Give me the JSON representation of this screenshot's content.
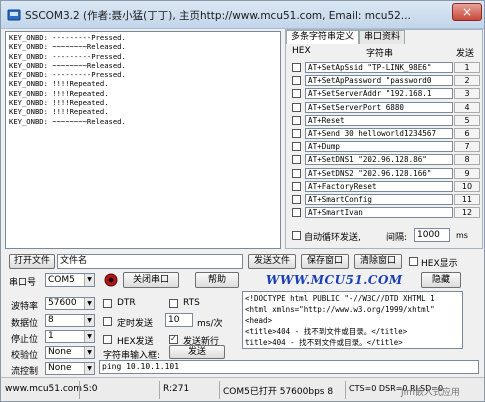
{
  "window": {
    "title": "SSCOM3.2 (作者:聂小猛(丁丁), 主页http://www.mcu51.com,  Email: mcu52...",
    "close": "×"
  },
  "receive_lines": [
    "KEY_ONBD: ---------Pressed.",
    "KEY_ONBD: ~~~~~~~~Released.",
    "KEY_ONBD: ---------Pressed.",
    "KEY_ONBD: ~~~~~~~~Released.",
    "KEY_ONBD: ---------Pressed.",
    "KEY_ONBD: !!!!Repeated.",
    "KEY_ONBD: !!!!Repeated.",
    "KEY_ONBD: !!!!Repeated.",
    "KEY_ONBD: !!!!Repeated.",
    "KEY_ONBD: ~~~~~~~~Released."
  ],
  "tabs": [
    "多条字符串定义",
    "串口资料"
  ],
  "multi_header": {
    "hex": "HEX",
    "string": "字符串",
    "send": "发送"
  },
  "commands": [
    {
      "text": "AT+SetApSsid \"TP-LINK_98E6\"",
      "num": "1"
    },
    {
      "text": "AT+SetApPassword \"password0",
      "num": "2"
    },
    {
      "text": "AT+SetServerAddr \"192.168.1",
      "num": "3"
    },
    {
      "text": "AT+SetServerPort 6880",
      "num": "4"
    },
    {
      "text": "AT+Reset",
      "num": "5"
    },
    {
      "text": "AT+Send 30 helloworld1234567",
      "num": "6"
    },
    {
      "text": "AT+Dump",
      "num": "7"
    },
    {
      "text": "AT+SetDNS1 \"202.96.128.86\"",
      "num": "8"
    },
    {
      "text": "AT+SetDNS2 \"202.96.128.166\"",
      "num": "9"
    },
    {
      "text": "AT+FactoryReset",
      "num": "10"
    },
    {
      "text": "AT+SmartConfig",
      "num": "11"
    },
    {
      "text": "AT+SmartIvan",
      "num": "12"
    }
  ],
  "auto_loop": {
    "label": "自动循环发送,",
    "interval_label": "间隔:",
    "interval": "1000",
    "unit": "ms"
  },
  "file_row": {
    "open_file": "打开文件",
    "file_name": "文件名",
    "send_file": "发送文件",
    "save_window": "保存窗口",
    "clear_window": "清除窗口",
    "hex_display": "HEX显示"
  },
  "port_row": {
    "label": "串口号",
    "port": "COM5",
    "close_port": "关闭串口",
    "help": "帮助",
    "hide": "隐藏"
  },
  "banner": "WWW.MCU51.COM",
  "settings": {
    "baud_label": "波特率",
    "baud": "57600",
    "data_label": "数据位",
    "data": "8",
    "stop_label": "停止位",
    "stop": "1",
    "parity_label": "校验位",
    "parity": "None",
    "flow_label": "流控制",
    "flow": "None"
  },
  "options": {
    "dtr": "DTR",
    "rts": "RTS",
    "timed_send": "定时发送",
    "interval": "10",
    "interval_unit": "ms/次",
    "hex_send": "HEX发送",
    "send_newline": "发送新行",
    "string_input_label": "字符串输入框:",
    "send_button": "发送"
  },
  "send_lines": [
    "<!DOCTYPE html PUBLIC \"-//W3C//DTD XHTML 1",
    "<html xmlns=\"http://www.w3.org/1999/xhtml\"",
    "<head>",
    "<title>404 - 找不到文件或目录。</title>",
    "title>404 - 找不到文件或目录。</title>"
  ],
  "input_text": "ping 10.10.1.101",
  "status": {
    "site": "www.mcu51.com",
    "s": "S:0",
    "r": "R:271",
    "port_state": "COM5已打开  57600bps 8",
    "lines": "CTS=0 DSR=0 RLSD=0",
    "watermark": "Jim嵌入式应用"
  }
}
